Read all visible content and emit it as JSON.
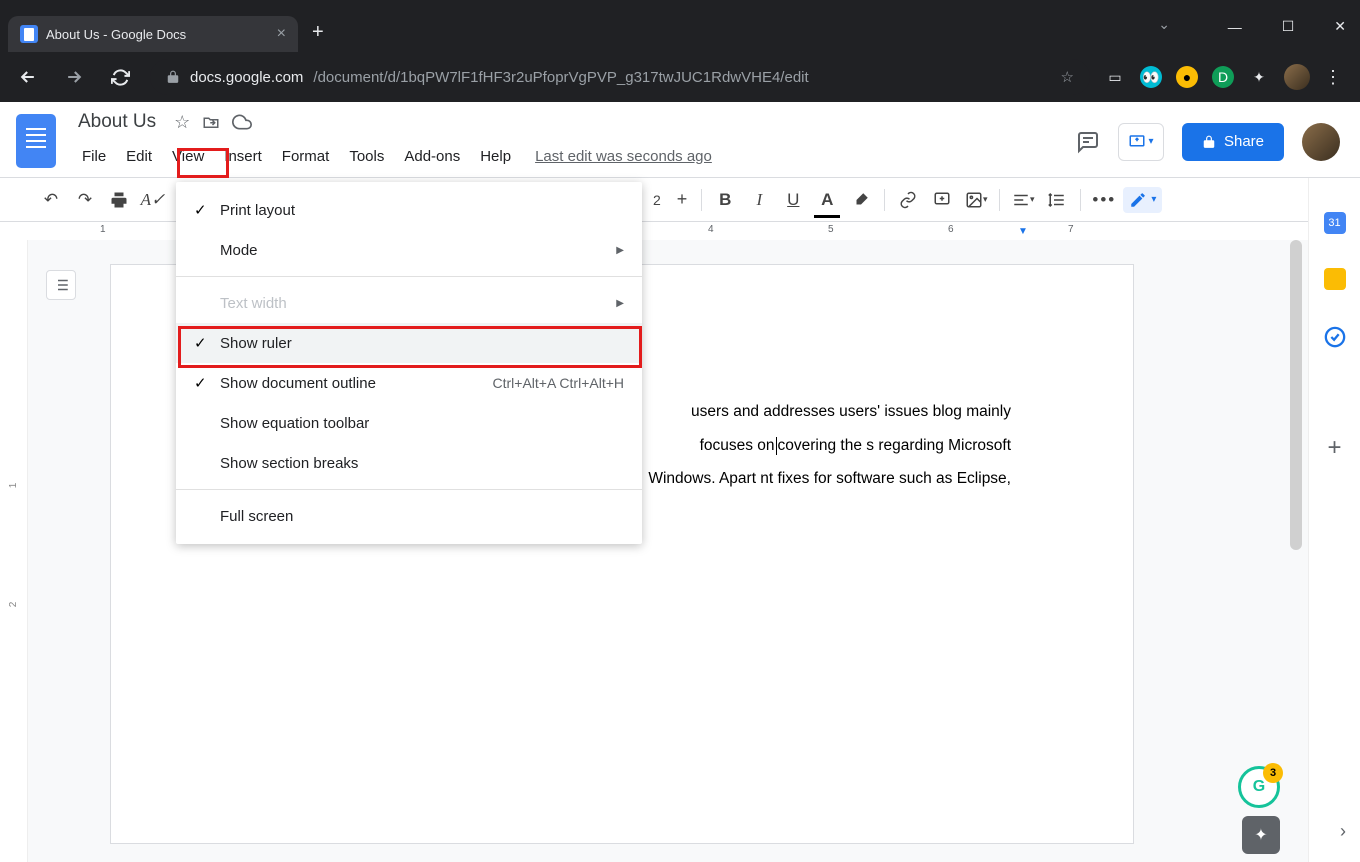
{
  "browser": {
    "tab_title": "About Us - Google Docs",
    "url_host": "docs.google.com",
    "url_path": "/document/d/1bqPW7lF1fHF3r2uPfoprVgPVP_g317twJUC1RdwVHE4/edit"
  },
  "doc": {
    "title": "About Us",
    "last_edit": "Last edit was seconds ago",
    "share": "Share",
    "body_before_cursor": "users and addresses users' issues blog mainly focuses on",
    "body_after_cursor": "covering the s regarding Microsoft Windows. Apart nt fixes for software such as Eclipse,"
  },
  "menus": {
    "file": "File",
    "edit": "Edit",
    "view": "View",
    "insert": "Insert",
    "format": "Format",
    "tools": "Tools",
    "addons": "Add-ons",
    "help": "Help"
  },
  "view_menu": {
    "print_layout": "Print layout",
    "mode": "Mode",
    "text_width": "Text width",
    "show_ruler": "Show ruler",
    "show_outline": "Show document outline",
    "show_outline_shortcut": "Ctrl+Alt+A Ctrl+Alt+H",
    "show_equation": "Show equation toolbar",
    "show_section": "Show section breaks",
    "full_screen": "Full screen"
  },
  "toolbar": {
    "zoom": "2"
  },
  "ruler": {
    "left": "1",
    "r4": "4",
    "r5": "5",
    "r6": "6",
    "r7": "7"
  },
  "vruler": {
    "v1": "1",
    "v2": "2"
  },
  "grammarly_count": "3"
}
